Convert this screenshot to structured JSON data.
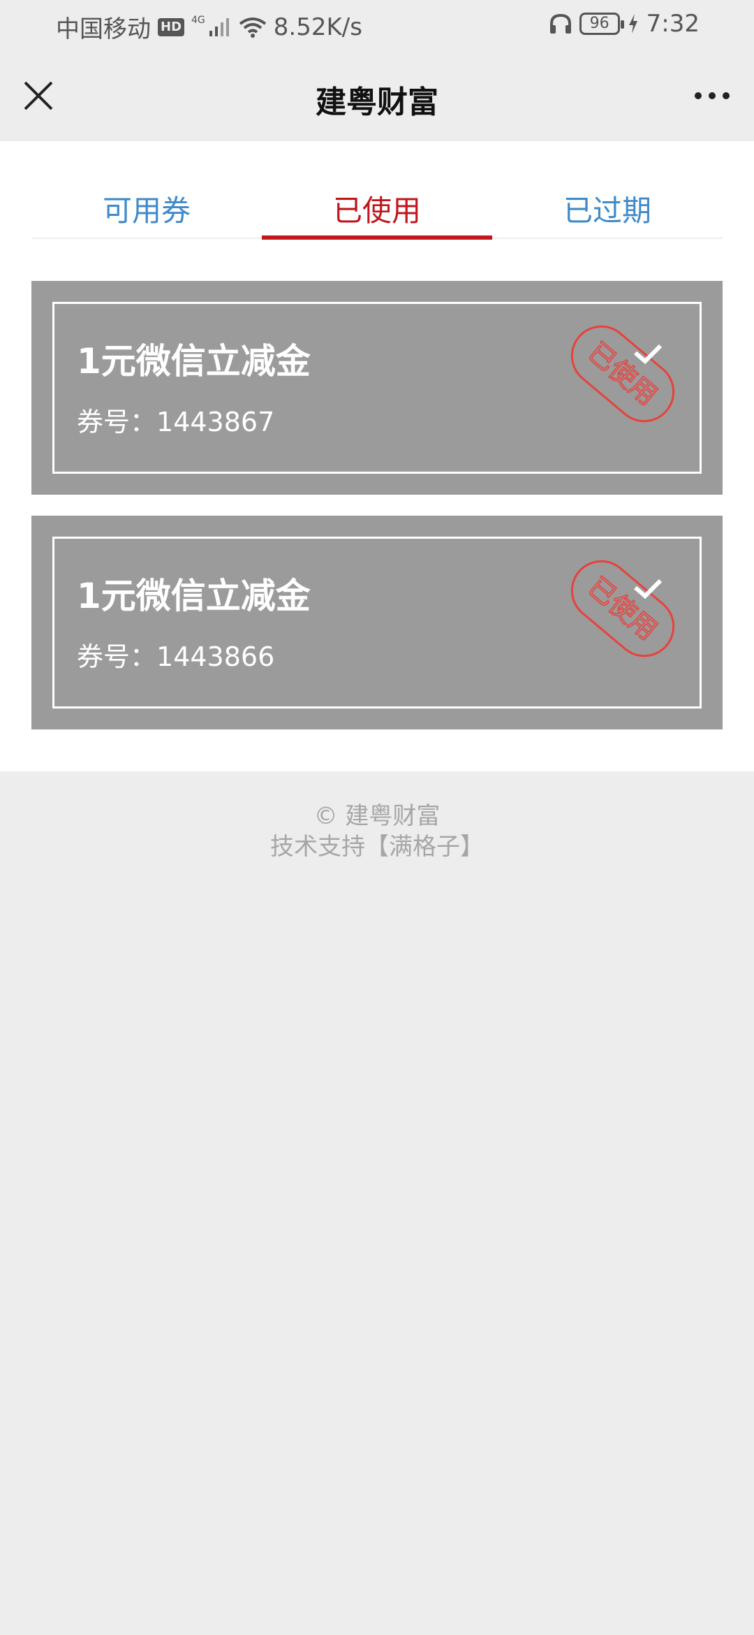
{
  "status_bar": {
    "carrier": "中国移动",
    "hd": "HD",
    "network": "4G",
    "speed": "8.52K/s",
    "battery": "96",
    "time": "7:32"
  },
  "nav": {
    "title": "建粤财富",
    "close_icon": "close-icon",
    "more_icon": "more-icon"
  },
  "tabs": [
    {
      "label": "可用券",
      "active": false
    },
    {
      "label": "已使用",
      "active": true
    },
    {
      "label": "已过期",
      "active": false
    }
  ],
  "coupons": [
    {
      "title": "1元微信立减金",
      "number_label": "券号：",
      "number": "1443867",
      "stamp": "已使用"
    },
    {
      "title": "1元微信立减金",
      "number_label": "券号：",
      "number": "1443866",
      "stamp": "已使用"
    }
  ],
  "footer": {
    "copyright": "© 建粤财富",
    "support": "技术支持【满格子】"
  },
  "colors": {
    "accent_red": "#c0161c",
    "tab_blue": "#3f8ac9",
    "stamp_red": "#e8413c",
    "coupon_bg": "#9b9b9b"
  }
}
